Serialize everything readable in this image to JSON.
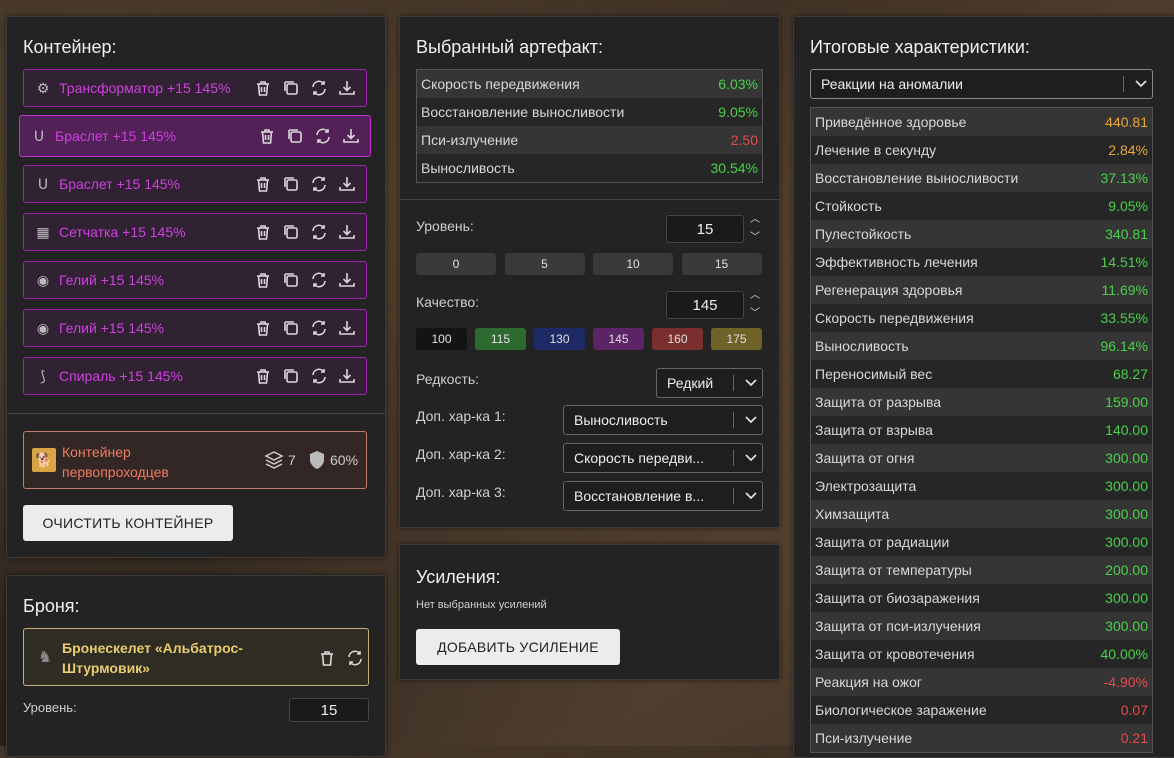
{
  "container": {
    "title": "Контейнер:",
    "items": [
      {
        "name": "Трансформатор +15 145%",
        "icon": "transformer-icon",
        "glyph": "⚙"
      },
      {
        "name": "Браслет +15 145%",
        "icon": "bracelet-icon",
        "glyph": "ᑌ"
      },
      {
        "name": "Браслет +15 145%",
        "icon": "bracelet-icon",
        "glyph": "ᑌ"
      },
      {
        "name": "Сетчатка +15 145%",
        "icon": "mesh-icon",
        "glyph": "▦"
      },
      {
        "name": "Гелий +15 145%",
        "icon": "helium-icon",
        "glyph": "◉"
      },
      {
        "name": "Гелий +15 145%",
        "icon": "helium-icon",
        "glyph": "◉"
      },
      {
        "name": "Спираль +15 145%",
        "icon": "spiral-icon",
        "glyph": "⟆"
      }
    ],
    "selected": {
      "name": "Контейнер первопроходцев",
      "slots": "7",
      "protection": "60%"
    },
    "clear_button": "ОЧИСТИТЬ КОНТЕЙНЕР"
  },
  "armor": {
    "title": "Броня:",
    "name": "Бронескелет «Альбатрос-Штурмовик»",
    "level_label": "Уровень:",
    "level_value": "15"
  },
  "artifact": {
    "title": "Выбранный артефакт:",
    "stats": [
      {
        "label": "Скорость передвижения",
        "value": "6.03%",
        "color": "#4cd04c"
      },
      {
        "label": "Восстановление выносливости",
        "value": "9.05%",
        "color": "#4cd04c"
      },
      {
        "label": "Пси-излучение",
        "value": "2.50",
        "color": "#e84a4a"
      },
      {
        "label": "Выносливость",
        "value": "30.54%",
        "color": "#4cd04c"
      }
    ],
    "level_label": "Уровень:",
    "level_value": "15",
    "level_presets": [
      "0",
      "5",
      "10",
      "15"
    ],
    "quality_label": "Качество:",
    "quality_value": "145",
    "quality_presets": [
      {
        "label": "100",
        "color": "#141414"
      },
      {
        "label": "115",
        "color": "#2e6a30"
      },
      {
        "label": "130",
        "color": "#1e2a66"
      },
      {
        "label": "145",
        "color": "#5a2466"
      },
      {
        "label": "160",
        "color": "#7a2e2e"
      },
      {
        "label": "175",
        "color": "#6e6228"
      }
    ],
    "rarity_label": "Редкость:",
    "rarity_value": "Редкий",
    "extra": [
      {
        "label": "Доп. хар-ка 1:",
        "value": "Выносливость"
      },
      {
        "label": "Доп. хар-ка 2:",
        "value": "Скорость передви..."
      },
      {
        "label": "Доп. хар-ка 3:",
        "value": "Восстановление в..."
      }
    ]
  },
  "boosts": {
    "title": "Усиления:",
    "empty": "Нет выбранных усилений",
    "add_button": "ДОБАВИТЬ УСИЛЕНИЕ"
  },
  "totals": {
    "title": "Итоговые характеристики:",
    "filter": "Реакции на аномалии",
    "stats": [
      {
        "label": "Приведённое здоровье",
        "value": "440.81",
        "color": "#e8a83a"
      },
      {
        "label": "Лечение в секунду",
        "value": "2.84%",
        "color": "#e8a83a"
      },
      {
        "label": "Восстановление выносливости",
        "value": "37.13%",
        "color": "#4cd04c"
      },
      {
        "label": "Стойкость",
        "value": "9.05%",
        "color": "#4cd04c"
      },
      {
        "label": "Пулестойкость",
        "value": "340.81",
        "color": "#4cd04c"
      },
      {
        "label": "Эффективность лечения",
        "value": "14.51%",
        "color": "#4cd04c"
      },
      {
        "label": "Регенерация здоровья",
        "value": "11.69%",
        "color": "#4cd04c"
      },
      {
        "label": "Скорость передвижения",
        "value": "33.55%",
        "color": "#4cd04c"
      },
      {
        "label": "Выносливость",
        "value": "96.14%",
        "color": "#4cd04c"
      },
      {
        "label": "Переносимый вес",
        "value": "68.27",
        "color": "#4cd04c"
      },
      {
        "label": "Защита от разрыва",
        "value": "159.00",
        "color": "#4cd04c"
      },
      {
        "label": "Защита от взрыва",
        "value": "140.00",
        "color": "#4cd04c"
      },
      {
        "label": "Защита от огня",
        "value": "300.00",
        "color": "#4cd04c"
      },
      {
        "label": "Электрозащита",
        "value": "300.00",
        "color": "#4cd04c"
      },
      {
        "label": "Химзащита",
        "value": "300.00",
        "color": "#4cd04c"
      },
      {
        "label": "Защита от радиации",
        "value": "300.00",
        "color": "#4cd04c"
      },
      {
        "label": "Защита от температуры",
        "value": "200.00",
        "color": "#4cd04c"
      },
      {
        "label": "Защита от биозаражения",
        "value": "300.00",
        "color": "#4cd04c"
      },
      {
        "label": "Защита от пси-излучения",
        "value": "300.00",
        "color": "#4cd04c"
      },
      {
        "label": "Защита от кровотечения",
        "value": "40.00%",
        "color": "#4cd04c"
      },
      {
        "label": "Реакция на ожог",
        "value": "-4.90%",
        "color": "#e84a4a"
      },
      {
        "label": "Биологическое заражение",
        "value": "0.07",
        "color": "#e84a4a"
      },
      {
        "label": "Пси-излучение",
        "value": "0.21",
        "color": "#e84a4a"
      }
    ]
  }
}
